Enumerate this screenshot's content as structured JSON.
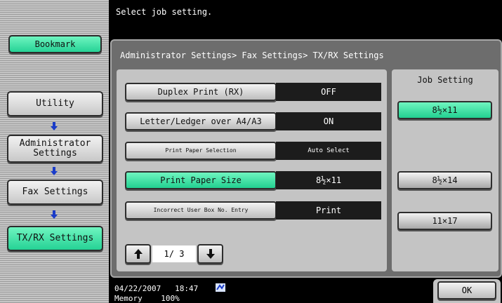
{
  "message": "Select job setting.",
  "nav": {
    "bookmark": "Bookmark",
    "utility": "Utility",
    "admin_settings": "Administrator Settings",
    "fax_settings": "Fax Settings",
    "txrx_settings": "TX/RX Settings"
  },
  "breadcrumb": "Administrator Settings> Fax Settings> TX/RX Settings",
  "settings": [
    {
      "label": "Duplex Print (RX)",
      "value": "OFF"
    },
    {
      "label": "Letter/Ledger over A4/A3",
      "value": "ON"
    },
    {
      "label": "Print Paper Selection",
      "value": "Auto Select"
    },
    {
      "label": "Print Paper Size",
      "value": "8½×11"
    },
    {
      "label": "Incorrect User Box No. Entry",
      "value": "Print"
    }
  ],
  "pager": {
    "text": "1/ 3"
  },
  "job_setting": {
    "title": "Job Setting",
    "options": [
      "8½×11",
      "8½×14",
      "11×17"
    ],
    "selected": "8½×11"
  },
  "footer": {
    "date": "04/22/2007",
    "time": "18:47",
    "memory_label": "Memory",
    "memory_value": "100%",
    "ok": "OK"
  },
  "colors": {
    "active_green": "#3be0a6",
    "background": "#000000",
    "panel": "#c4c4c4"
  },
  "icons": [
    "up-arrow-icon",
    "down-arrow-icon",
    "network-icon"
  ]
}
